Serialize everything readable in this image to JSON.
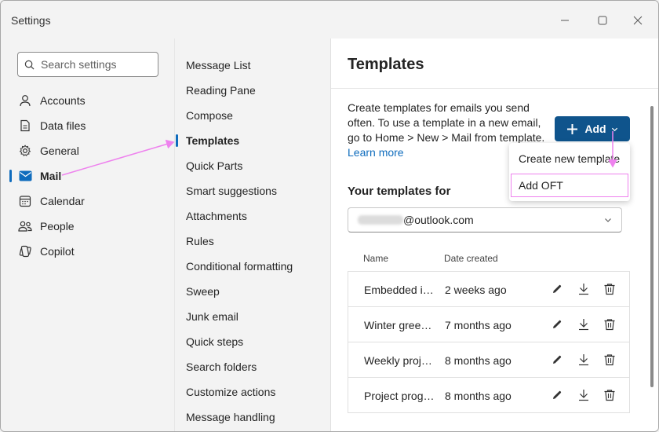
{
  "window": {
    "title": "Settings",
    "controls": {
      "minimize": "minimize-icon",
      "maximize": "maximize-icon",
      "close": "close-icon"
    }
  },
  "search": {
    "placeholder": "Search settings"
  },
  "nav": {
    "items": [
      {
        "label": "Accounts",
        "icon": "person-icon"
      },
      {
        "label": "Data files",
        "icon": "document-icon"
      },
      {
        "label": "General",
        "icon": "gear-icon"
      },
      {
        "label": "Mail",
        "icon": "mail-icon",
        "active": true
      },
      {
        "label": "Calendar",
        "icon": "calendar-icon"
      },
      {
        "label": "People",
        "icon": "people-icon"
      },
      {
        "label": "Copilot",
        "icon": "copilot-icon"
      }
    ]
  },
  "mail_settings": {
    "items": [
      "Message List",
      "Reading Pane",
      "Compose",
      "Templates",
      "Quick Parts",
      "Smart suggestions",
      "Attachments",
      "Rules",
      "Conditional formatting",
      "Sweep",
      "Junk email",
      "Quick steps",
      "Search folders",
      "Customize actions",
      "Message handling"
    ],
    "active": "Templates"
  },
  "templates": {
    "title": "Templates",
    "description": "Create templates for emails you send often. To use a template in a new email, go to Home > New > Mail from template.",
    "learn_more": "Learn more",
    "add_label": "Add",
    "menu": {
      "create_new": "Create new template",
      "add_oft": "Add OFT"
    },
    "your_templates_label": "Your templates for",
    "account_suffix": "@outlook.com",
    "columns": {
      "name": "Name",
      "date": "Date created"
    },
    "rows": [
      {
        "name": "Embedded images",
        "date": "2 weeks ago"
      },
      {
        "name": "Winter greetings",
        "date": "7 months ago"
      },
      {
        "name": "Weekly project update",
        "date": "8 months ago"
      },
      {
        "name": "Project progress",
        "date": "8 months ago"
      }
    ]
  },
  "colors": {
    "accent": "#0f6cbd",
    "add_button": "#0f548c",
    "annotation": "#ee82ee"
  }
}
